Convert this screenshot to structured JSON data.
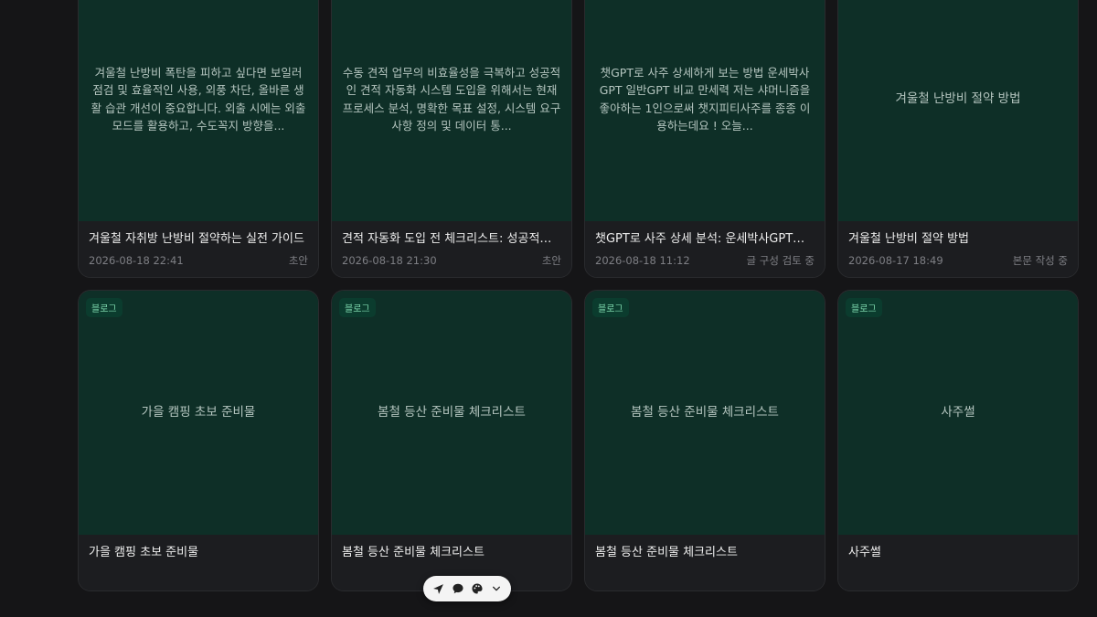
{
  "cards": [
    {
      "thumb": "겨울철 난방비 폭탄을 피하고 싶다면 보일러 점검 및 효율적인 사용, 외풍 차단, 올바른 생활 습관 개선이 중요합니다. 외출 시에는 외출 모드를 활용하고, 수도꼭지 방향을...",
      "title": "겨울철 자취방 난방비 절약하는 실전 가이드",
      "date": "2026-08-18 22:41",
      "status": "초안"
    },
    {
      "thumb": "수동 견적 업무의 비효율성을 극복하고 성공적인 견적 자동화 시스템 도입을 위해서는 현재 프로세스 분석, 명확한 목표 설정, 시스템 요구사항 정의 및 데이터 통...",
      "title": "견적 자동화 도입 전 체크리스트: 성공적인 도입을 위한 가이드",
      "date": "2026-08-18 21:30",
      "status": "초안"
    },
    {
      "thumb": "챗GPT로 사주 상세하게 보는 방법 운세박사GPT 일반GPT 비교 만세력 저는 샤머니즘을 좋아하는 1인으로써 챗지피티사주를 종종 이용하는데요 ! 오늘...",
      "title": "챗GPT로 사주 상세 분석: 운세박사GPT와 일반GPT 비교",
      "date": "2026-08-18 11:12",
      "status": "글 구성 검토 중"
    },
    {
      "thumb": "겨울철 난방비 절약 방법",
      "title": "겨울철 난방비 절약 방법",
      "date": "2026-08-17 18:49",
      "status": "본문 작성 중"
    },
    {
      "badge": "블로그",
      "thumb": "가을 캠핑 초보 준비물",
      "title": "가을 캠핑 초보 준비물"
    },
    {
      "badge": "블로그",
      "thumb": "봄철 등산 준비물 체크리스트",
      "title": "봄철 등산 준비물 체크리스트"
    },
    {
      "badge": "블로그",
      "thumb": "봄철 등산 준비물 체크리스트",
      "title": "봄철 등산 준비물 체크리스트"
    },
    {
      "badge": "블로그",
      "thumb": "사주썰",
      "title": "사주썰"
    }
  ],
  "toolbar": {
    "icons": [
      "send-icon",
      "chat-bubble-icon",
      "palette-icon",
      "chevron-down-icon"
    ]
  },
  "colors": {
    "background": "#151517",
    "thumbnail": "#0e2f27",
    "badge_text": "#7ed9ad",
    "toolbar": "#f4f4f4"
  }
}
